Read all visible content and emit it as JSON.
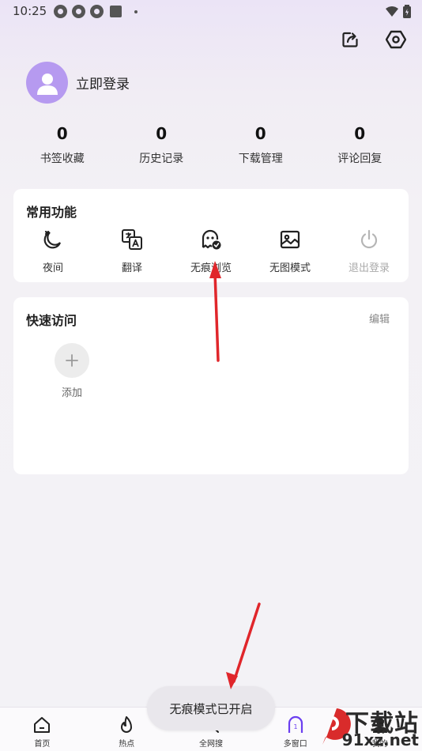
{
  "status_bar": {
    "time": "10:25"
  },
  "profile": {
    "login_label": "立即登录"
  },
  "stats": [
    {
      "value": "0",
      "label": "书签收藏"
    },
    {
      "value": "0",
      "label": "历史记录"
    },
    {
      "value": "0",
      "label": "下载管理"
    },
    {
      "value": "0",
      "label": "评论回复"
    }
  ],
  "common_functions": {
    "title": "常用功能",
    "items": [
      {
        "label": "夜间",
        "icon": "moon-icon"
      },
      {
        "label": "翻译",
        "icon": "translate-icon"
      },
      {
        "label": "无痕浏览",
        "icon": "ghost-icon"
      },
      {
        "label": "无图模式",
        "icon": "no-image-icon"
      },
      {
        "label": "退出登录",
        "icon": "power-icon"
      }
    ]
  },
  "quick_access": {
    "title": "快速访问",
    "edit_label": "编辑",
    "add_label": "添加"
  },
  "bottom_nav": [
    {
      "label": "首页",
      "icon": "home-icon"
    },
    {
      "label": "热点",
      "icon": "flame-icon"
    },
    {
      "label": "全网搜",
      "icon": "search-icon"
    },
    {
      "label": "多窗口",
      "icon": "windows-icon",
      "badge": "1"
    },
    {
      "label": "我的",
      "icon": "user-icon"
    }
  ],
  "toast": {
    "message": "无痕模式已开启"
  },
  "watermark": {
    "main": "下载站",
    "sub": "91xz.net"
  },
  "colors": {
    "accent": "#b69af0",
    "annotation_arrow": "#e0262b",
    "nav_active": "#6b3ff0"
  }
}
